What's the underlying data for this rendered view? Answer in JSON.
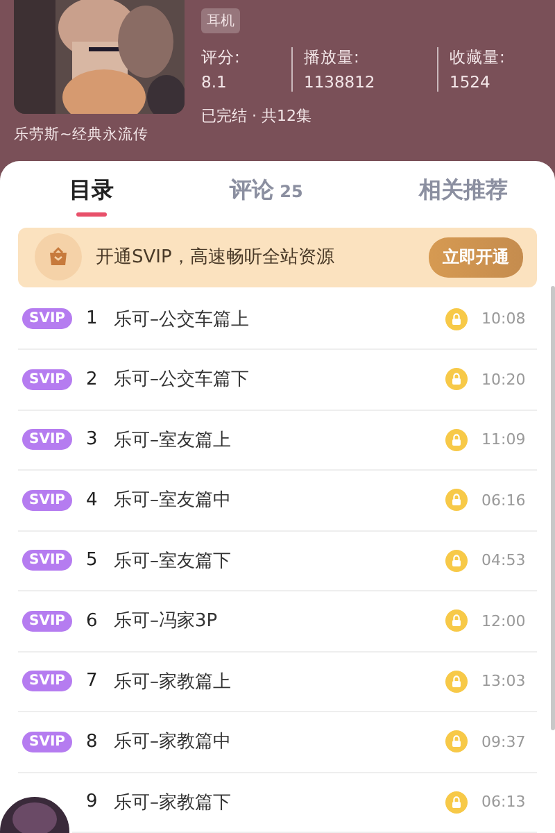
{
  "header": {
    "title": "乐劳斯~经典永流传",
    "tags": [
      "耳机"
    ],
    "stats": [
      {
        "label": "评分:",
        "value": "8.1"
      },
      {
        "label": "播放量:",
        "value": "1138812"
      },
      {
        "label": "收藏量:",
        "value": "1524"
      }
    ],
    "status": "已完结 · 共12集"
  },
  "tabs": [
    {
      "label": "目录",
      "selected": true
    },
    {
      "label": "评论",
      "count": "25",
      "selected": false
    },
    {
      "label": "相关推荐",
      "selected": false
    }
  ],
  "vip_banner": {
    "text": "开通SVIP，高速畅听全站资源",
    "button": "立即开通"
  },
  "episodes": [
    {
      "badge": "SVIP",
      "number": "1",
      "title": "乐可–公交车篇上",
      "locked": true,
      "duration": "10:08"
    },
    {
      "badge": "SVIP",
      "number": "2",
      "title": "乐可–公交车篇下",
      "locked": true,
      "duration": "10:20"
    },
    {
      "badge": "SVIP",
      "number": "3",
      "title": "乐可–室友篇上",
      "locked": true,
      "duration": "11:09"
    },
    {
      "badge": "SVIP",
      "number": "4",
      "title": "乐可–室友篇中",
      "locked": true,
      "duration": "06:16"
    },
    {
      "badge": "SVIP",
      "number": "5",
      "title": "乐可–室友篇下",
      "locked": true,
      "duration": "04:53"
    },
    {
      "badge": "SVIP",
      "number": "6",
      "title": "乐可–冯家3P",
      "locked": true,
      "duration": "12:00"
    },
    {
      "badge": "SVIP",
      "number": "7",
      "title": "乐可–家教篇上",
      "locked": true,
      "duration": "13:03"
    },
    {
      "badge": "SVIP",
      "number": "8",
      "title": "乐可–家教篇中",
      "locked": true,
      "duration": "09:37"
    },
    {
      "number": "9",
      "title": "乐可–家教篇下",
      "locked": true,
      "duration": "06:13"
    }
  ]
}
